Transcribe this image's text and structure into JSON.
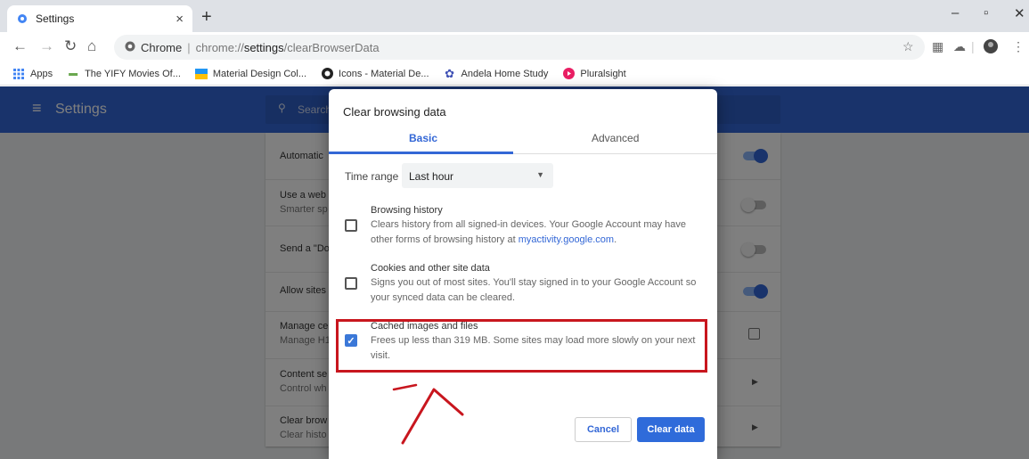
{
  "browser": {
    "tab_title": "Settings",
    "tab_close": "×",
    "new_tab": "+",
    "window_controls": [
      "–",
      "▫",
      "✕"
    ],
    "site_label": "Chrome",
    "url_prefix": "chrome://",
    "url_bold": "settings",
    "url_suffix": "/clearBrowserData"
  },
  "bookmarks": [
    {
      "label": "Apps",
      "icon": "apps-grid-icon",
      "color": "#4285f4"
    },
    {
      "label": "The YIFY Movies Of...",
      "icon": "yify-icon",
      "color": "#6aa84f"
    },
    {
      "label": "Material Design Col...",
      "icon": "material-design-icon",
      "color": "#2196f3"
    },
    {
      "label": "Icons - Material De...",
      "icon": "github-icon",
      "color": "#222222"
    },
    {
      "label": "Andela Home Study",
      "icon": "andela-icon",
      "color": "#3f51b5"
    },
    {
      "label": "Pluralsight",
      "icon": "pluralsight-icon",
      "color": "#e91e63"
    }
  ],
  "settings": {
    "title": "Settings",
    "search_placeholder": "Search",
    "rows": [
      {
        "text": "Automatic",
        "sub": "",
        "control": "toggle-on"
      },
      {
        "text": "Use a web",
        "sub": "Smarter sp",
        "control": "toggle-off"
      },
      {
        "text": "Send a \"Do",
        "sub": "",
        "control": "toggle-off"
      },
      {
        "text": "Allow sites",
        "sub": "",
        "control": "toggle-on"
      },
      {
        "text": "Manage ce",
        "sub": "Manage H1",
        "control": "external"
      },
      {
        "text": "Content se",
        "sub": "Control wh",
        "control": "arrow"
      },
      {
        "text": "Clear brow",
        "sub": "Clear histo",
        "control": "arrow"
      }
    ]
  },
  "dialog": {
    "title": "Clear browsing data",
    "tabs": {
      "basic": "Basic",
      "advanced": "Advanced"
    },
    "time_range_label": "Time range",
    "time_range_value": "Last hour",
    "options": [
      {
        "title": "Browsing history",
        "desc": "Clears history from all signed-in devices. Your Google Account may have other forms of browsing history at ",
        "link": "myactivity.google.com",
        "desc_end": ".",
        "checked": false
      },
      {
        "title": "Cookies and other site data",
        "desc": "Signs you out of most sites. You'll stay signed in to your Google Account so your synced data can be cleared.",
        "checked": false
      },
      {
        "title": "Cached images and files",
        "desc": "Frees up less than 319 MB. Some sites may load more slowly on your next visit.",
        "checked": true
      }
    ],
    "cancel_label": "Cancel",
    "clear_label": "Clear data"
  },
  "colors": {
    "accent": "#3367d6",
    "annotation": "#c8161e"
  }
}
